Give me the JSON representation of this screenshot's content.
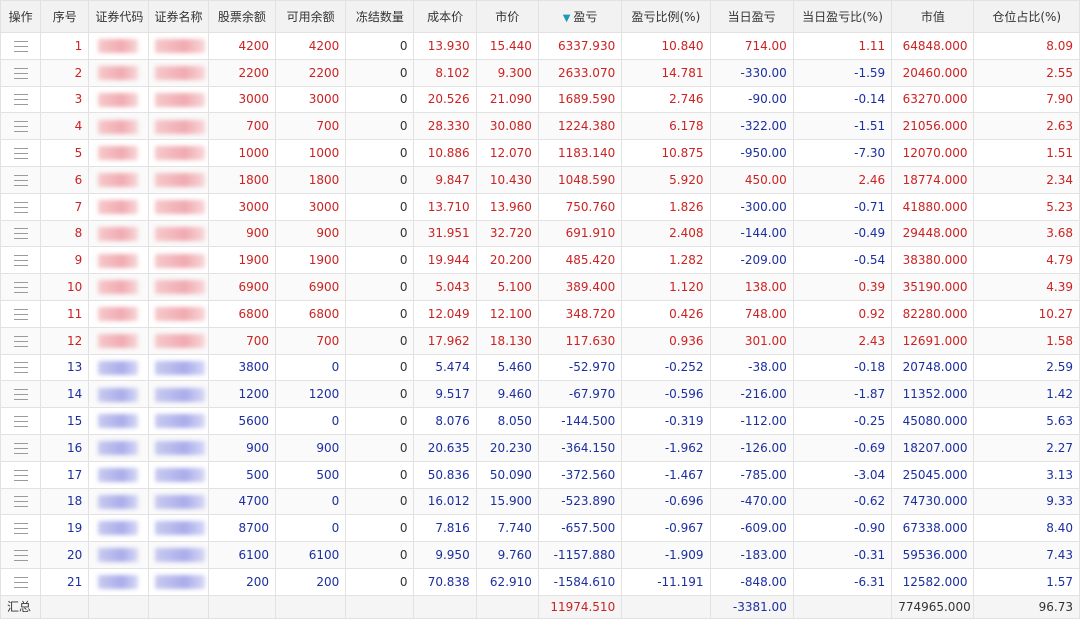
{
  "columns": [
    "操作",
    "序号",
    "证券代码",
    "证券名称",
    "股票余额",
    "可用余额",
    "冻结数量",
    "成本价",
    "市价",
    "盈亏",
    "盈亏比例(%)",
    "当日盈亏",
    "当日盈亏比(%)",
    "市值",
    "仓位占比(%)"
  ],
  "sort_indicator": "▼",
  "rows": [
    {
      "seq": "1",
      "balance": "4200",
      "avail": "4200",
      "frozen": "0",
      "cost": "13.930",
      "price": "15.440",
      "pnl": "6337.930",
      "pnl_pct": "10.840",
      "day_pnl": "714.00",
      "day_pct": "1.11",
      "mkt": "64848.000",
      "pos": "8.09",
      "sign": "pos",
      "day_sign": "pos"
    },
    {
      "seq": "2",
      "balance": "2200",
      "avail": "2200",
      "frozen": "0",
      "cost": "8.102",
      "price": "9.300",
      "pnl": "2633.070",
      "pnl_pct": "14.781",
      "day_pnl": "-330.00",
      "day_pct": "-1.59",
      "mkt": "20460.000",
      "pos": "2.55",
      "sign": "pos",
      "day_sign": "neg"
    },
    {
      "seq": "3",
      "balance": "3000",
      "avail": "3000",
      "frozen": "0",
      "cost": "20.526",
      "price": "21.090",
      "pnl": "1689.590",
      "pnl_pct": "2.746",
      "day_pnl": "-90.00",
      "day_pct": "-0.14",
      "mkt": "63270.000",
      "pos": "7.90",
      "sign": "pos",
      "day_sign": "neg"
    },
    {
      "seq": "4",
      "balance": "700",
      "avail": "700",
      "frozen": "0",
      "cost": "28.330",
      "price": "30.080",
      "pnl": "1224.380",
      "pnl_pct": "6.178",
      "day_pnl": "-322.00",
      "day_pct": "-1.51",
      "mkt": "21056.000",
      "pos": "2.63",
      "sign": "pos",
      "day_sign": "neg"
    },
    {
      "seq": "5",
      "balance": "1000",
      "avail": "1000",
      "frozen": "0",
      "cost": "10.886",
      "price": "12.070",
      "pnl": "1183.140",
      "pnl_pct": "10.875",
      "day_pnl": "-950.00",
      "day_pct": "-7.30",
      "mkt": "12070.000",
      "pos": "1.51",
      "sign": "pos",
      "day_sign": "neg"
    },
    {
      "seq": "6",
      "balance": "1800",
      "avail": "1800",
      "frozen": "0",
      "cost": "9.847",
      "price": "10.430",
      "pnl": "1048.590",
      "pnl_pct": "5.920",
      "day_pnl": "450.00",
      "day_pct": "2.46",
      "mkt": "18774.000",
      "pos": "2.34",
      "sign": "pos",
      "day_sign": "pos"
    },
    {
      "seq": "7",
      "balance": "3000",
      "avail": "3000",
      "frozen": "0",
      "cost": "13.710",
      "price": "13.960",
      "pnl": "750.760",
      "pnl_pct": "1.826",
      "day_pnl": "-300.00",
      "day_pct": "-0.71",
      "mkt": "41880.000",
      "pos": "5.23",
      "sign": "pos",
      "day_sign": "neg"
    },
    {
      "seq": "8",
      "balance": "900",
      "avail": "900",
      "frozen": "0",
      "cost": "31.951",
      "price": "32.720",
      "pnl": "691.910",
      "pnl_pct": "2.408",
      "day_pnl": "-144.00",
      "day_pct": "-0.49",
      "mkt": "29448.000",
      "pos": "3.68",
      "sign": "pos",
      "day_sign": "neg"
    },
    {
      "seq": "9",
      "balance": "1900",
      "avail": "1900",
      "frozen": "0",
      "cost": "19.944",
      "price": "20.200",
      "pnl": "485.420",
      "pnl_pct": "1.282",
      "day_pnl": "-209.00",
      "day_pct": "-0.54",
      "mkt": "38380.000",
      "pos": "4.79",
      "sign": "pos",
      "day_sign": "neg"
    },
    {
      "seq": "10",
      "balance": "6900",
      "avail": "6900",
      "frozen": "0",
      "cost": "5.043",
      "price": "5.100",
      "pnl": "389.400",
      "pnl_pct": "1.120",
      "day_pnl": "138.00",
      "day_pct": "0.39",
      "mkt": "35190.000",
      "pos": "4.39",
      "sign": "pos",
      "day_sign": "pos"
    },
    {
      "seq": "11",
      "balance": "6800",
      "avail": "6800",
      "frozen": "0",
      "cost": "12.049",
      "price": "12.100",
      "pnl": "348.720",
      "pnl_pct": "0.426",
      "day_pnl": "748.00",
      "day_pct": "0.92",
      "mkt": "82280.000",
      "pos": "10.27",
      "sign": "pos",
      "day_sign": "pos"
    },
    {
      "seq": "12",
      "balance": "700",
      "avail": "700",
      "frozen": "0",
      "cost": "17.962",
      "price": "18.130",
      "pnl": "117.630",
      "pnl_pct": "0.936",
      "day_pnl": "301.00",
      "day_pct": "2.43",
      "mkt": "12691.000",
      "pos": "1.58",
      "sign": "pos",
      "day_sign": "pos"
    },
    {
      "seq": "13",
      "balance": "3800",
      "avail": "0",
      "frozen": "0",
      "cost": "5.474",
      "price": "5.460",
      "pnl": "-52.970",
      "pnl_pct": "-0.252",
      "day_pnl": "-38.00",
      "day_pct": "-0.18",
      "mkt": "20748.000",
      "pos": "2.59",
      "sign": "neg",
      "day_sign": "neg"
    },
    {
      "seq": "14",
      "balance": "1200",
      "avail": "1200",
      "frozen": "0",
      "cost": "9.517",
      "price": "9.460",
      "pnl": "-67.970",
      "pnl_pct": "-0.596",
      "day_pnl": "-216.00",
      "day_pct": "-1.87",
      "mkt": "11352.000",
      "pos": "1.42",
      "sign": "neg",
      "day_sign": "neg"
    },
    {
      "seq": "15",
      "balance": "5600",
      "avail": "0",
      "frozen": "0",
      "cost": "8.076",
      "price": "8.050",
      "pnl": "-144.500",
      "pnl_pct": "-0.319",
      "day_pnl": "-112.00",
      "day_pct": "-0.25",
      "mkt": "45080.000",
      "pos": "5.63",
      "sign": "neg",
      "day_sign": "neg"
    },
    {
      "seq": "16",
      "balance": "900",
      "avail": "900",
      "frozen": "0",
      "cost": "20.635",
      "price": "20.230",
      "pnl": "-364.150",
      "pnl_pct": "-1.962",
      "day_pnl": "-126.00",
      "day_pct": "-0.69",
      "mkt": "18207.000",
      "pos": "2.27",
      "sign": "neg",
      "day_sign": "neg"
    },
    {
      "seq": "17",
      "balance": "500",
      "avail": "500",
      "frozen": "0",
      "cost": "50.836",
      "price": "50.090",
      "pnl": "-372.560",
      "pnl_pct": "-1.467",
      "day_pnl": "-785.00",
      "day_pct": "-3.04",
      "mkt": "25045.000",
      "pos": "3.13",
      "sign": "neg",
      "day_sign": "neg"
    },
    {
      "seq": "18",
      "balance": "4700",
      "avail": "0",
      "frozen": "0",
      "cost": "16.012",
      "price": "15.900",
      "pnl": "-523.890",
      "pnl_pct": "-0.696",
      "day_pnl": "-470.00",
      "day_pct": "-0.62",
      "mkt": "74730.000",
      "pos": "9.33",
      "sign": "neg",
      "day_sign": "neg"
    },
    {
      "seq": "19",
      "balance": "8700",
      "avail": "0",
      "frozen": "0",
      "cost": "7.816",
      "price": "7.740",
      "pnl": "-657.500",
      "pnl_pct": "-0.967",
      "day_pnl": "-609.00",
      "day_pct": "-0.90",
      "mkt": "67338.000",
      "pos": "8.40",
      "sign": "neg",
      "day_sign": "neg"
    },
    {
      "seq": "20",
      "balance": "6100",
      "avail": "6100",
      "frozen": "0",
      "cost": "9.950",
      "price": "9.760",
      "pnl": "-1157.880",
      "pnl_pct": "-1.909",
      "day_pnl": "-183.00",
      "day_pct": "-0.31",
      "mkt": "59536.000",
      "pos": "7.43",
      "sign": "neg",
      "day_sign": "neg"
    },
    {
      "seq": "21",
      "balance": "200",
      "avail": "200",
      "frozen": "0",
      "cost": "70.838",
      "price": "62.910",
      "pnl": "-1584.610",
      "pnl_pct": "-11.191",
      "day_pnl": "-848.00",
      "day_pct": "-6.31",
      "mkt": "12582.000",
      "pos": "1.57",
      "sign": "neg",
      "day_sign": "neg"
    }
  ],
  "summary": {
    "label": "汇总",
    "pnl": "11974.510",
    "day_pnl": "-3381.00",
    "mkt": "774965.000",
    "pos": "96.73"
  },
  "colors": {
    "positive": "#cc2222",
    "negative": "#1c2fa0",
    "sort_arrow": "#1b9bb4"
  }
}
